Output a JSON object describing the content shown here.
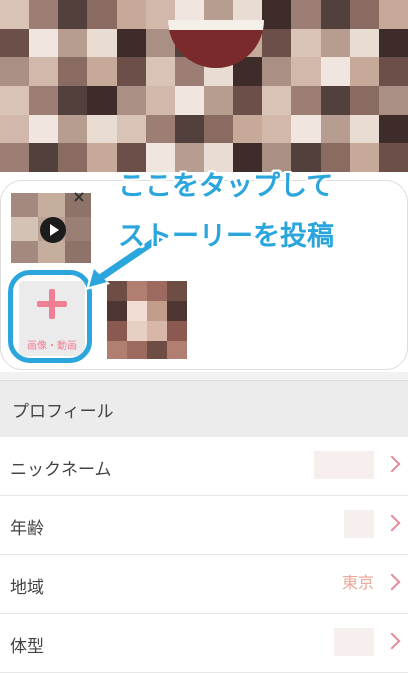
{
  "annotation": {
    "line1": "ここをタップして",
    "line2": "ストーリーを投稿"
  },
  "stories": {
    "add_button_label": "画像・動画",
    "close_glyph": "×"
  },
  "profile": {
    "section_title": "プロフィール",
    "rows": [
      {
        "label": "ニックネーム",
        "value": ""
      },
      {
        "label": "年齢",
        "value": ""
      },
      {
        "label": "地域",
        "value": "東京"
      },
      {
        "label": "体型",
        "value": ""
      }
    ]
  },
  "colors": {
    "accent_blue": "#2aa6dc",
    "accent_pink": "#f07f95"
  },
  "icons": {
    "play": "play-icon",
    "plus": "plus-icon",
    "close": "close-icon",
    "chevron": "chevron-right-icon",
    "arrow": "arrow-icon"
  }
}
